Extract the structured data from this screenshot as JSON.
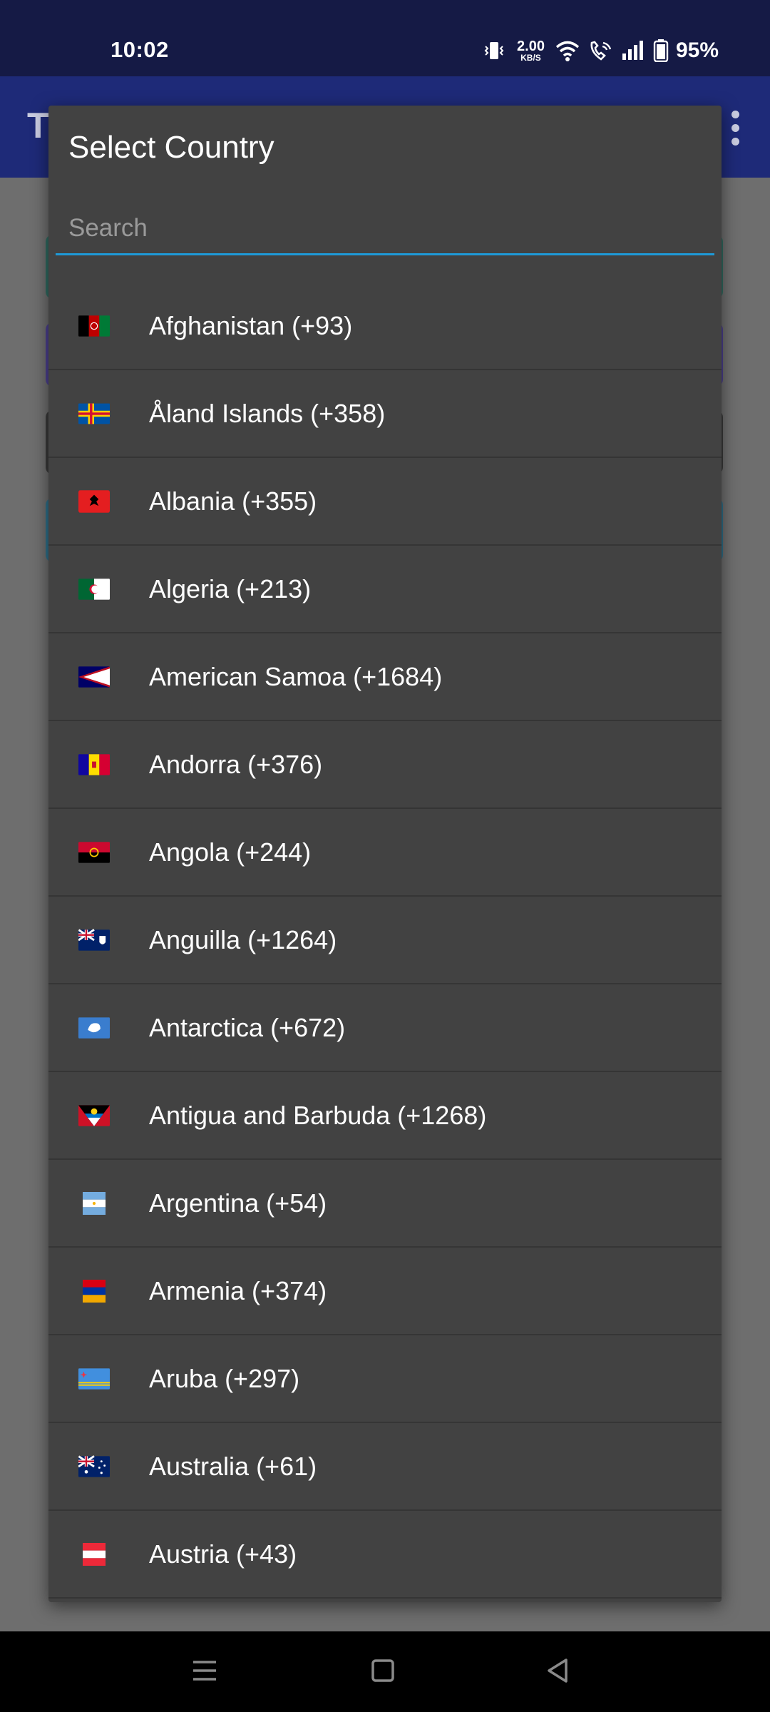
{
  "status_bar": {
    "time": "10:02",
    "net_speed_value": "2.00",
    "net_speed_unit": "KB/S",
    "battery": "95%",
    "icons": [
      "vibrate-icon",
      "wifi-icon",
      "wifi-call-icon",
      "signal-icon",
      "battery-icon"
    ]
  },
  "app_bar": {
    "title_stub": "T"
  },
  "dialog": {
    "title": "Select Country",
    "search_placeholder": "Search",
    "countries": [
      {
        "label": "Afghanistan (+93)",
        "flag": "af"
      },
      {
        "label": "Åland Islands (+358)",
        "flag": "ax"
      },
      {
        "label": "Albania (+355)",
        "flag": "al"
      },
      {
        "label": "Algeria (+213)",
        "flag": "dz"
      },
      {
        "label": "American Samoa (+1684)",
        "flag": "as"
      },
      {
        "label": "Andorra (+376)",
        "flag": "ad"
      },
      {
        "label": "Angola (+244)",
        "flag": "ao"
      },
      {
        "label": "Anguilla (+1264)",
        "flag": "ai"
      },
      {
        "label": "Antarctica (+672)",
        "flag": "aq"
      },
      {
        "label": "Antigua and Barbuda (+1268)",
        "flag": "ag"
      },
      {
        "label": "Argentina (+54)",
        "flag": "ar"
      },
      {
        "label": "Armenia (+374)",
        "flag": "am"
      },
      {
        "label": "Aruba (+297)",
        "flag": "aw"
      },
      {
        "label": "Australia (+61)",
        "flag": "au"
      },
      {
        "label": "Austria (+43)",
        "flag": "at"
      }
    ]
  },
  "nav_bar": {
    "buttons": [
      "menu-icon",
      "home-icon",
      "back-icon"
    ]
  },
  "colors": {
    "status_bar": "#151a45",
    "app_bar": "#1e2a78",
    "dialog_bg": "#424242",
    "accent": "#1e9ad8"
  }
}
